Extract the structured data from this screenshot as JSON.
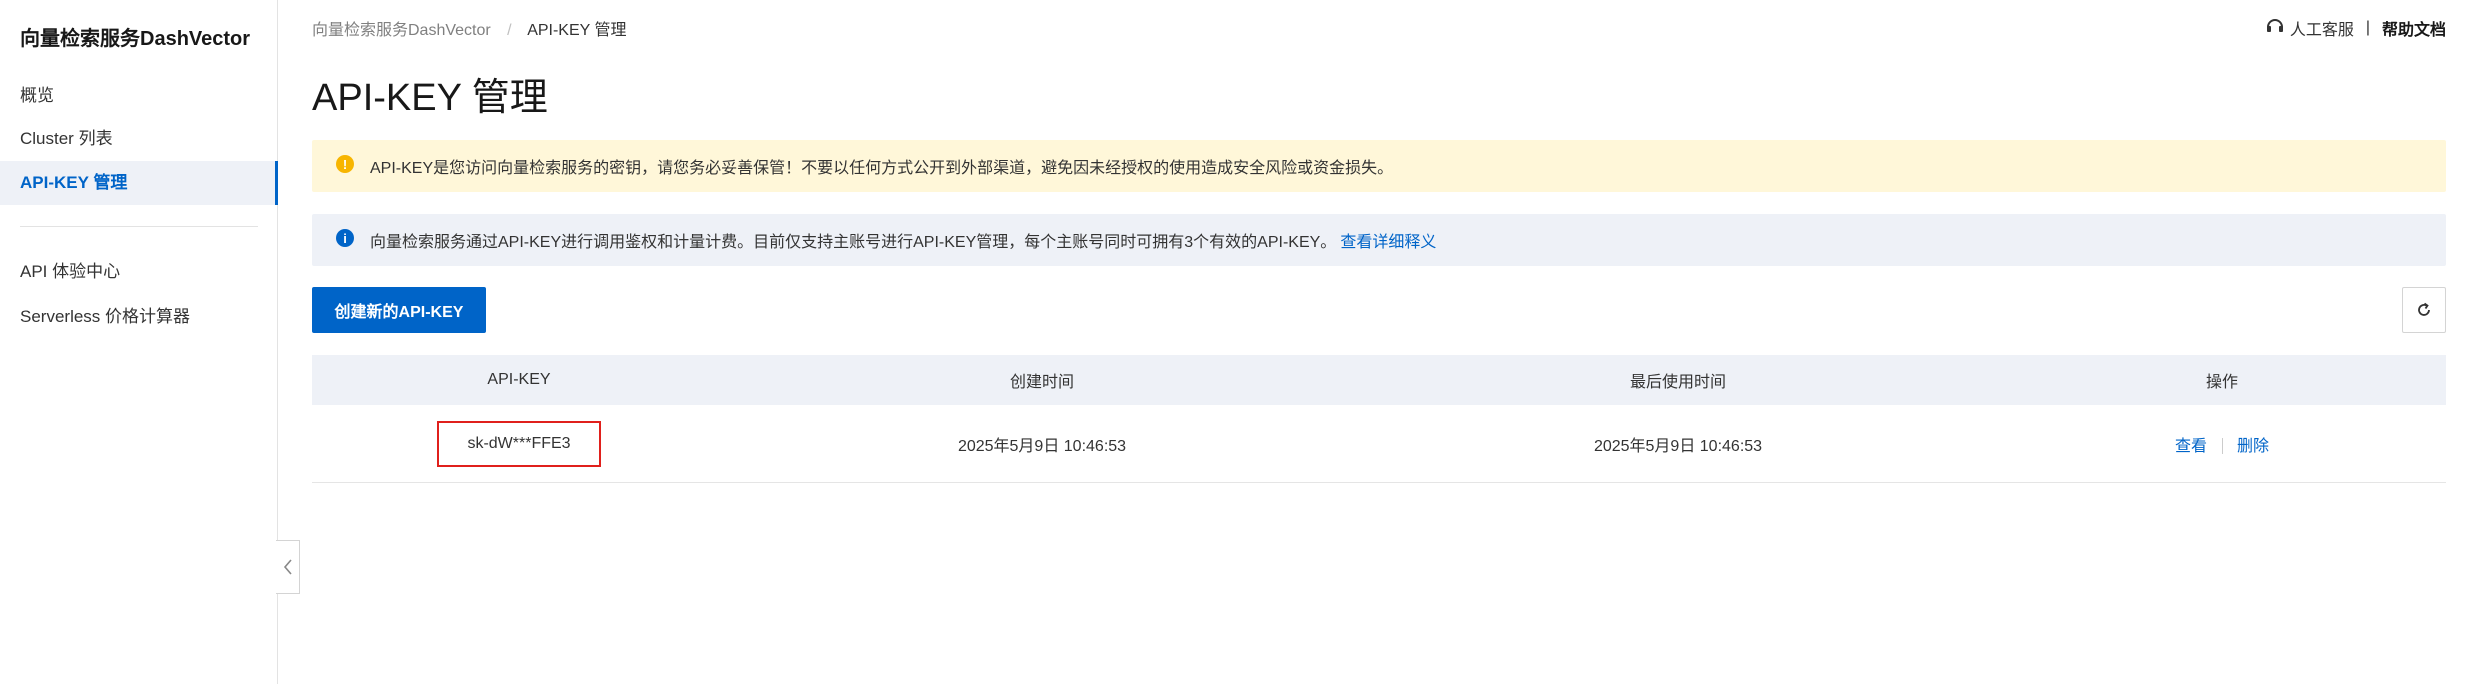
{
  "sidebar": {
    "title": "向量检索服务DashVector",
    "items": [
      {
        "label": "概览"
      },
      {
        "label": "Cluster 列表"
      },
      {
        "label": "API-KEY 管理"
      },
      {
        "label": "API 体验中心"
      },
      {
        "label": "Serverless 价格计算器"
      }
    ],
    "active_index": 2
  },
  "header": {
    "breadcrumb": [
      "向量检索服务DashVector",
      "API-KEY 管理"
    ],
    "breadcrumb_sep": "/",
    "support_label": "人工客服",
    "divider": "|",
    "help_label": "帮助文档"
  },
  "page": {
    "title": "API-KEY 管理"
  },
  "alerts": {
    "warning_text": "API-KEY是您访问向量检索服务的密钥，请您务必妥善保管！不要以任何方式公开到外部渠道，避免因未经授权的使用造成安全风险或资金损失。",
    "info_text": "向量检索服务通过API-KEY进行调用鉴权和计量计费。目前仅支持主账号进行API-KEY管理，每个主账号同时可拥有3个有效的API-KEY。",
    "info_link": "查看详细释义"
  },
  "toolbar": {
    "create_label": "创建新的API-KEY"
  },
  "table": {
    "columns": [
      "API-KEY",
      "创建时间",
      "最后使用时间",
      "操作"
    ],
    "rows": [
      {
        "key": "sk-dW***FFE3",
        "created": "2025年5月9日 10:46:53",
        "last_used": "2025年5月9日 10:46:53",
        "actions": [
          "查看",
          "删除"
        ]
      }
    ]
  },
  "colors": {
    "accent": "#0064c8",
    "warning_bg": "#fff7d9",
    "info_bg": "#eef1f7",
    "highlight_border": "#e0201c"
  }
}
